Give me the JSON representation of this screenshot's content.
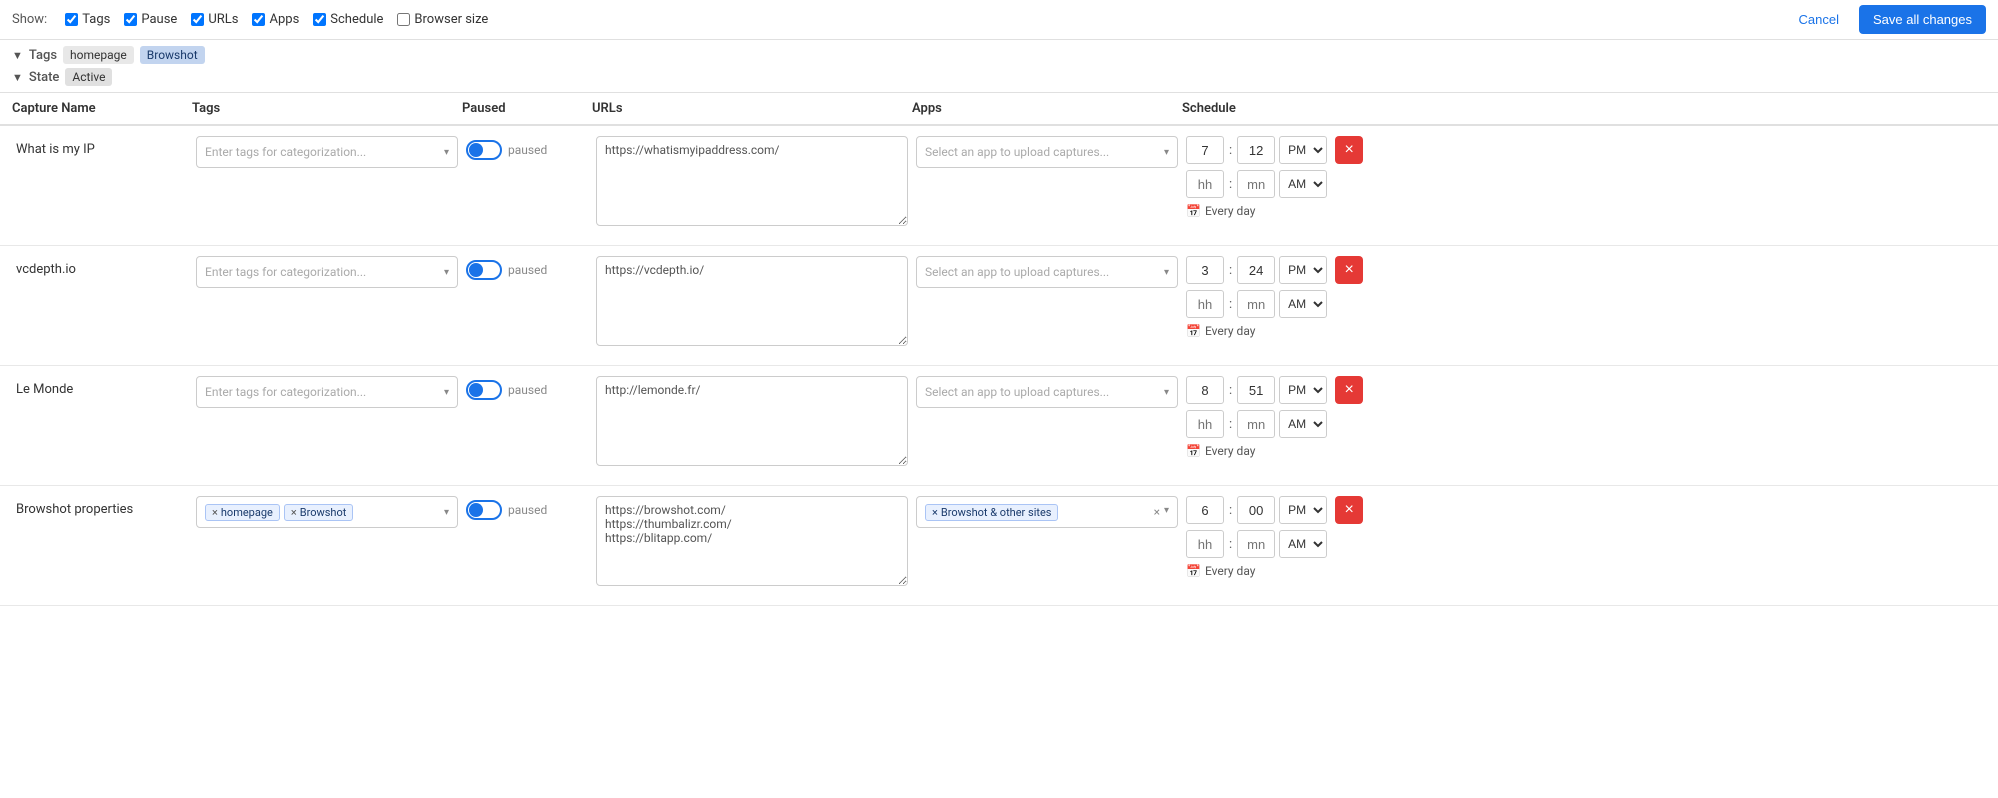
{
  "topbar": {
    "show_label": "Show:",
    "filters": [
      {
        "id": "tags",
        "label": "Tags",
        "checked": true
      },
      {
        "id": "pause",
        "label": "Pause",
        "checked": true
      },
      {
        "id": "urls",
        "label": "URLs",
        "checked": true
      },
      {
        "id": "apps",
        "label": "Apps",
        "checked": true
      },
      {
        "id": "schedule",
        "label": "Schedule",
        "checked": true
      },
      {
        "id": "browser_size",
        "label": "Browser size",
        "checked": false
      }
    ],
    "cancel_label": "Cancel",
    "save_label": "Save all changes"
  },
  "active_filters": {
    "tags_label": "Tags",
    "tags": [
      "homepage",
      "Browshot"
    ],
    "state_label": "State",
    "state_value": "Active"
  },
  "table": {
    "headers": [
      "Capture Name",
      "Tags",
      "Paused",
      "URLs",
      "Apps",
      "Schedule"
    ],
    "rows": [
      {
        "name": "What is my IP",
        "tags": [],
        "tags_placeholder": "Enter tags for categorization...",
        "paused": true,
        "paused_label": "paused",
        "url": "https://whatismyipaddress.com/",
        "app_placeholder": "Select an app to upload captures...",
        "app_value": null,
        "schedule_hour1": "7",
        "schedule_min1": "12",
        "schedule_ampm1": "PM",
        "schedule_hour2": "hh",
        "schedule_min2": "mn",
        "schedule_ampm2": "AM",
        "schedule_recurrence": "Every day"
      },
      {
        "name": "vcdepth.io",
        "tags": [],
        "tags_placeholder": "Enter tags for categorization...",
        "paused": true,
        "paused_label": "paused",
        "url": "https://vcdepth.io/",
        "app_placeholder": "Select an app to upload captures...",
        "app_value": null,
        "schedule_hour1": "3",
        "schedule_min1": "24",
        "schedule_ampm1": "PM",
        "schedule_hour2": "hh",
        "schedule_min2": "mn",
        "schedule_ampm2": "AM",
        "schedule_recurrence": "Every day"
      },
      {
        "name": "Le Monde",
        "tags": [],
        "tags_placeholder": "Enter tags for categorization...",
        "paused": true,
        "paused_label": "paused",
        "url": "http://lemonde.fr/",
        "app_placeholder": "Select an app to upload captures...",
        "app_value": null,
        "schedule_hour1": "8",
        "schedule_min1": "51",
        "schedule_ampm1": "PM",
        "schedule_hour2": "hh",
        "schedule_min2": "mn",
        "schedule_ampm2": "AM",
        "schedule_recurrence": "Every day"
      },
      {
        "name": "Browshot properties",
        "tags": [
          "homepage",
          "Browshot"
        ],
        "tags_placeholder": "",
        "paused": true,
        "paused_label": "paused",
        "url": "https://browshot.com/\nhttps://thumbalizr.com/\nhttps://blitapp.com/",
        "app_placeholder": "",
        "app_value": "Browshot & other sites",
        "schedule_hour1": "6",
        "schedule_min1": "00",
        "schedule_ampm1": "PM",
        "schedule_hour2": "hh",
        "schedule_min2": "mn",
        "schedule_ampm2": "AM",
        "schedule_recurrence": "Every day"
      }
    ]
  }
}
